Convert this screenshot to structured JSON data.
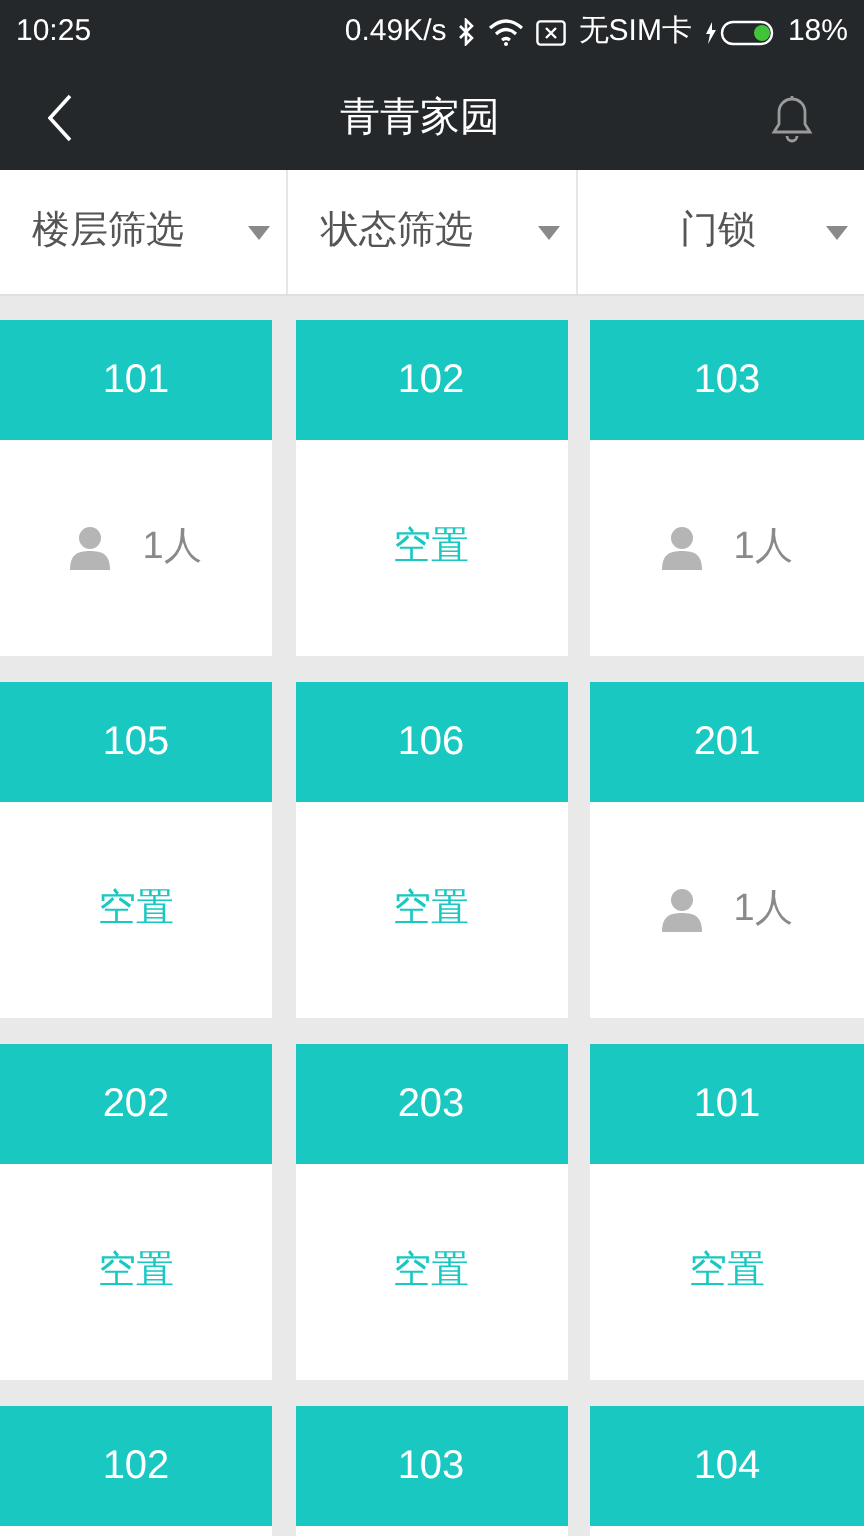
{
  "status_bar": {
    "time": "10:25",
    "speed": "0.49K/s",
    "carrier": "无SIM卡",
    "battery": "18%"
  },
  "header": {
    "title": "青青家园"
  },
  "filters": [
    {
      "label": "楼层筛选"
    },
    {
      "label": "状态筛选"
    },
    {
      "label": "门锁"
    }
  ],
  "rooms": [
    {
      "number": "101",
      "kind": "occupied",
      "status": "1人"
    },
    {
      "number": "102",
      "kind": "vacant",
      "status": "空置"
    },
    {
      "number": "103",
      "kind": "occupied",
      "status": "1人"
    },
    {
      "number": "105",
      "kind": "vacant",
      "status": "空置"
    },
    {
      "number": "106",
      "kind": "vacant",
      "status": "空置"
    },
    {
      "number": "201",
      "kind": "occupied",
      "status": "1人"
    },
    {
      "number": "202",
      "kind": "vacant",
      "status": "空置"
    },
    {
      "number": "203",
      "kind": "vacant",
      "status": "空置"
    },
    {
      "number": "101",
      "kind": "vacant",
      "status": "空置"
    },
    {
      "number": "102"
    },
    {
      "number": "103"
    },
    {
      "number": "104"
    }
  ]
}
